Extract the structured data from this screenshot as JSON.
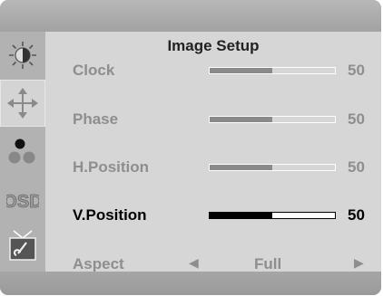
{
  "menu": {
    "title": "Image Setup",
    "items": [
      {
        "label": "Clock",
        "value": "50",
        "level": 0.5
      },
      {
        "label": "Phase",
        "value": "50",
        "level": 0.5
      },
      {
        "label": "H.Position",
        "value": "50",
        "level": 0.5
      },
      {
        "label": "V.Position",
        "value": "50",
        "level": 0.5
      }
    ],
    "aspect": {
      "label": "Aspect",
      "value": "Full"
    },
    "selected_item": "V.Position",
    "selected_category": "image-setup"
  },
  "sidebar": {
    "icons": [
      "brightness-icon",
      "move-arrows-icon",
      "color-dots-icon",
      "osd-icon",
      "tools-icon"
    ],
    "osd_text": "OSD"
  },
  "colors": {
    "panel": "#d6d6d6",
    "sidebar": "#b2b2b2",
    "active_text": "#000000",
    "inactive_text": "#8e8e8e"
  }
}
